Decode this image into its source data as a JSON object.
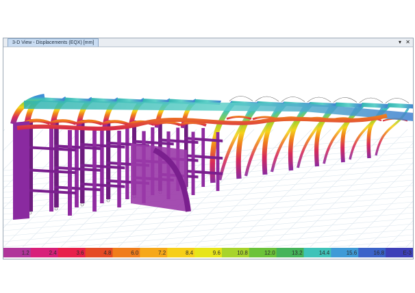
{
  "window": {
    "tab_title": "3-D View  - Displacements (EQX)  [mm]",
    "controls": {
      "dropdown_glyph": "▾",
      "close_glyph": "✕"
    }
  },
  "legend": {
    "labels": [
      "1.2",
      "2.4",
      "3.6",
      "4.8",
      "6.0",
      "7.2",
      "8.4",
      "9.6",
      "10.8",
      "12.0",
      "13.2",
      "14.4",
      "15.6",
      "16.8",
      "E-3"
    ],
    "colors": [
      "#b0359a",
      "#d8207a",
      "#e8204a",
      "#e54a25",
      "#f07d1c",
      "#f6a81a",
      "#f6cf1a",
      "#e7e51a",
      "#a8d42c",
      "#6cc33a",
      "#45b45a",
      "#3fc3b9",
      "#3f9bd7",
      "#3b63c9",
      "#3d3fb8"
    ]
  },
  "model": {
    "frame_colors": {
      "column": "#8f2aa0",
      "column_dark": "#6d1c7e",
      "gradient": [
        "#8a2aa0",
        "#d62a5a",
        "#f07d1c",
        "#f6d21a",
        "#9fd02e",
        "#3fc3b9",
        "#3f8fd7"
      ]
    }
  }
}
